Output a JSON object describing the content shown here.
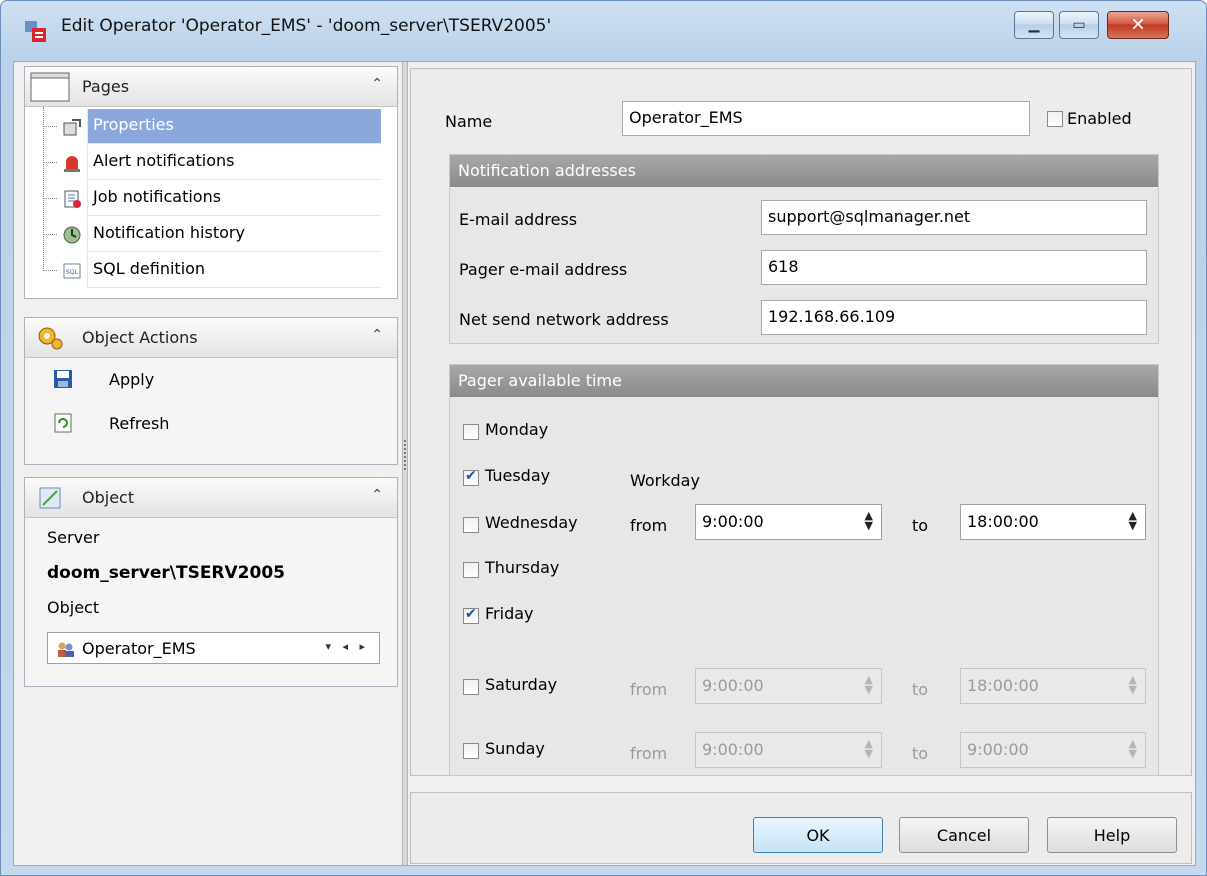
{
  "window": {
    "title": "Edit Operator 'Operator_EMS' - 'doom_server\\TSERV2005'"
  },
  "pages": {
    "header": "Pages",
    "items": [
      {
        "label": "Properties"
      },
      {
        "label": "Alert notifications"
      },
      {
        "label": "Job notifications"
      },
      {
        "label": "Notification history"
      },
      {
        "label": "SQL definition"
      }
    ]
  },
  "actions": {
    "header": "Object Actions",
    "items": [
      {
        "label": "Apply"
      },
      {
        "label": "Refresh"
      }
    ]
  },
  "object": {
    "header": "Object",
    "server_label": "Server",
    "server_value": "doom_server\\TSERV2005",
    "object_label": "Object",
    "object_value": "Operator_EMS"
  },
  "form": {
    "name_label": "Name",
    "name_value": "Operator_EMS",
    "enabled_label": "Enabled",
    "enabled": false,
    "notif": {
      "header": "Notification addresses",
      "email_label": "E-mail address",
      "email_value": "support@sqlmanager.net",
      "pager_label": "Pager e-mail address",
      "pager_value": "618",
      "netsend_label": "Net send network address",
      "netsend_value": "192.168.66.109"
    },
    "pager": {
      "header": "Pager available time",
      "workday_label": "Workday",
      "from_label": "from",
      "to_label": "to",
      "days": [
        {
          "label": "Monday",
          "checked": false
        },
        {
          "label": "Tuesday",
          "checked": true
        },
        {
          "label": "Wednesday",
          "checked": false
        },
        {
          "label": "Thursday",
          "checked": false
        },
        {
          "label": "Friday",
          "checked": true
        },
        {
          "label": "Saturday",
          "checked": false
        },
        {
          "label": "Sunday",
          "checked": false
        }
      ],
      "workday_from": "9:00:00",
      "workday_to": "18:00:00",
      "saturday_from": "9:00:00",
      "saturday_to": "18:00:00",
      "sunday_from": "9:00:00",
      "sunday_to": "9:00:00"
    }
  },
  "buttons": {
    "ok": "OK",
    "cancel": "Cancel",
    "help": "Help"
  }
}
